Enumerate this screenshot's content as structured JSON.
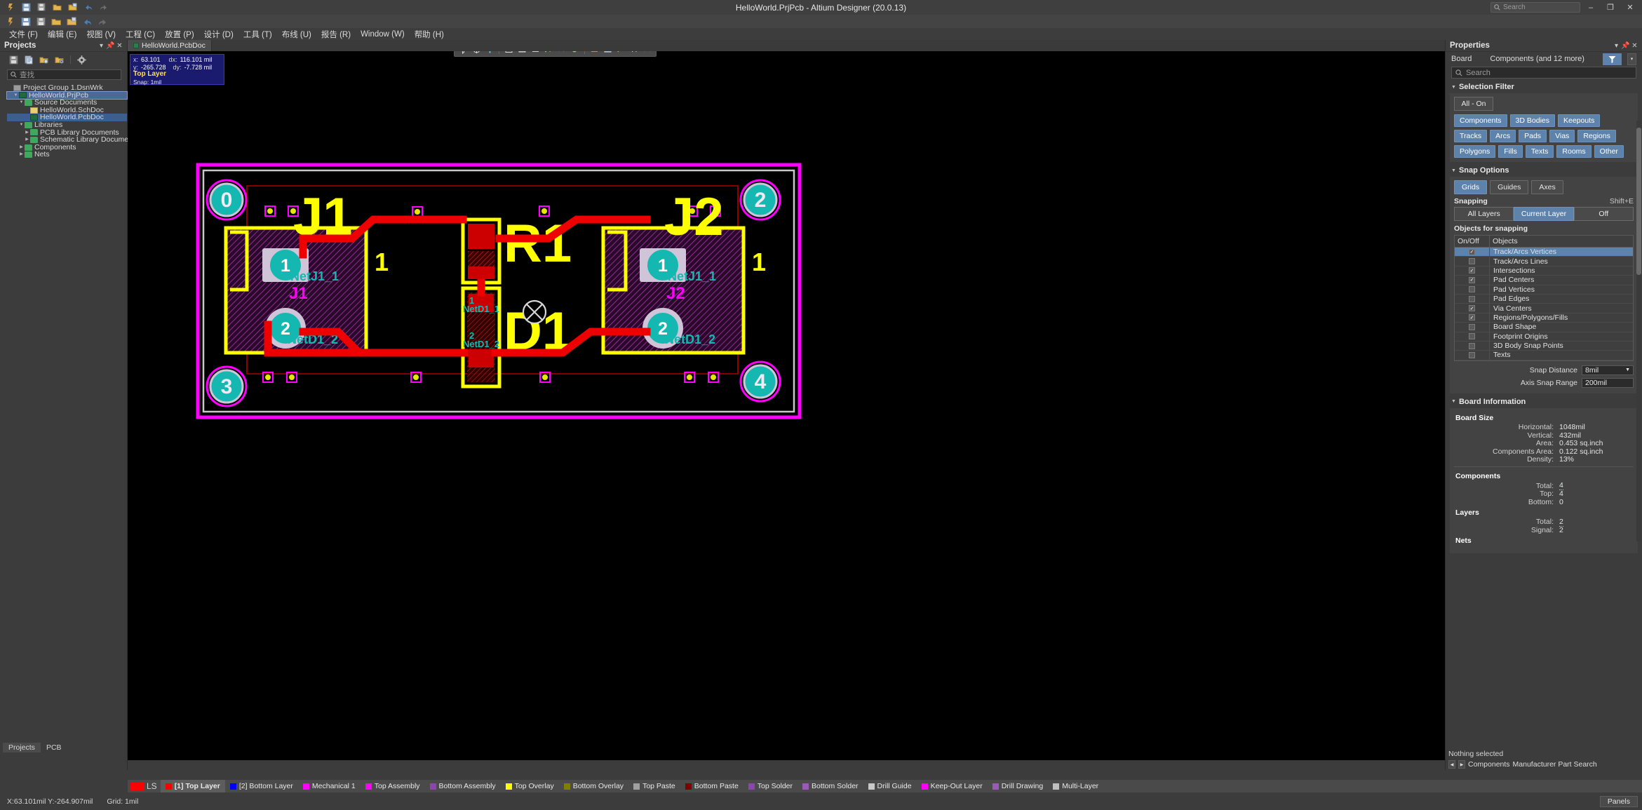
{
  "window": {
    "title": "HelloWorld.PrjPcb - Altium Designer (20.0.13)",
    "search_placeholder": "Search",
    "minimize": "–",
    "maximize": "❐",
    "close": "✕"
  },
  "menu": {
    "items": [
      "文件 (F)",
      "编辑 (E)",
      "视图 (V)",
      "工程 (C)",
      "放置 (P)",
      "设计 (D)",
      "工具 (T)",
      "布线 (U)",
      "报告 (R)",
      "Window (W)",
      "帮助 (H)"
    ]
  },
  "projects_panel": {
    "title": "Projects",
    "search_placeholder": "查找",
    "tree": [
      {
        "label": "Project Group 1.DsnWrk",
        "indent": 0,
        "arrow": "",
        "icon": "workspace-icon",
        "selected": false
      },
      {
        "label": "HelloWorld.PrjPcb",
        "indent": 1,
        "arrow": "▼",
        "icon": "pcb-project-icon",
        "selected": "outline"
      },
      {
        "label": "Source Documents",
        "indent": 2,
        "arrow": "▼",
        "icon": "folder-icon",
        "selected": false
      },
      {
        "label": "HelloWorld.SchDoc",
        "indent": 3,
        "arrow": "",
        "icon": "schematic-icon",
        "selected": false
      },
      {
        "label": "HelloWorld.PcbDoc",
        "indent": 3,
        "arrow": "",
        "icon": "pcbdoc-icon",
        "selected": true
      },
      {
        "label": "Libraries",
        "indent": 2,
        "arrow": "▼",
        "icon": "folder-icon",
        "selected": false
      },
      {
        "label": "PCB Library Documents",
        "indent": 3,
        "arrow": "▶",
        "icon": "folder-icon",
        "selected": false
      },
      {
        "label": "Schematic Library Documen",
        "indent": 3,
        "arrow": "▶",
        "icon": "folder-icon",
        "selected": false
      },
      {
        "label": "Components",
        "indent": 2,
        "arrow": "▶",
        "icon": "folder-icon",
        "selected": false
      },
      {
        "label": "Nets",
        "indent": 2,
        "arrow": "▶",
        "icon": "folder-icon",
        "selected": false
      }
    ],
    "bottom_tabs": [
      {
        "label": "Projects",
        "active": true
      },
      {
        "label": "PCB",
        "active": false
      }
    ]
  },
  "document_tabs": [
    {
      "label": "HelloWorld.PcbDoc",
      "active": true
    }
  ],
  "canvas_hud": {
    "x_label": "x:",
    "x_value": "63.101",
    "dx_label": "dx:",
    "dx_value": "116.101 mil",
    "y_label": "y:",
    "y_value": "-265.728",
    "dy_label": "dy:",
    "dy_value": "-7.728  mil",
    "layer": "Top Layer",
    "snap": "Snap: 1mil"
  },
  "pcb": {
    "designators": [
      "J1",
      "J2",
      "R1",
      "D1"
    ],
    "pad_labels": [
      "1",
      "2"
    ],
    "net_labels": [
      "NetJ1_1",
      "NetD1_2",
      "NetJ1_1",
      "NetD1_2",
      "NetD1_1",
      "NetD1_2"
    ],
    "mounting_holes": [
      "0",
      "2",
      "3",
      "4"
    ],
    "comp_names": [
      "J1",
      "J2"
    ],
    "pin_numbers": [
      "1",
      "1"
    ],
    "colors": {
      "board_outline": "#ff00ff",
      "top_layer": "#ff0000",
      "top_overlay": "#ffff00",
      "pad": "#bdb3c8",
      "keepout": "#ff00ff",
      "hole": "#14b8b0"
    }
  },
  "properties_panel": {
    "title": "Properties",
    "object_type": "Board",
    "object_summary": "Components (and 12 more)",
    "search_placeholder": "Search",
    "selection_filter": {
      "title": "Selection Filter",
      "all_on": "All - On",
      "chips": [
        {
          "label": "Components",
          "on": true
        },
        {
          "label": "3D Bodies",
          "on": true
        },
        {
          "label": "Keepouts",
          "on": true
        },
        {
          "label": "Tracks",
          "on": true
        },
        {
          "label": "Arcs",
          "on": true
        },
        {
          "label": "Pads",
          "on": true
        },
        {
          "label": "Vias",
          "on": true
        },
        {
          "label": "Regions",
          "on": true
        },
        {
          "label": "Polygons",
          "on": true
        },
        {
          "label": "Fills",
          "on": true
        },
        {
          "label": "Texts",
          "on": true
        },
        {
          "label": "Rooms",
          "on": true
        },
        {
          "label": "Other",
          "on": true
        }
      ]
    },
    "snap_options": {
      "title": "Snap Options",
      "modes": [
        {
          "label": "Grids",
          "on": true
        },
        {
          "label": "Guides",
          "on": false
        },
        {
          "label": "Axes",
          "on": false
        }
      ],
      "snapping_label": "Snapping",
      "snapping_shortcut": "Shift+E",
      "snapping_segments": [
        {
          "label": "All Layers",
          "on": false
        },
        {
          "label": "Current Layer",
          "on": true
        },
        {
          "label": "Off",
          "on": false
        }
      ],
      "objects_label": "Objects for snapping",
      "table_headers": [
        "On/Off",
        "Objects"
      ],
      "objects": [
        {
          "label": "Track/Arcs Vertices",
          "checked": true,
          "selected": true
        },
        {
          "label": "Track/Arcs Lines",
          "checked": false,
          "selected": false
        },
        {
          "label": "Intersections",
          "checked": true,
          "selected": false
        },
        {
          "label": "Pad Centers",
          "checked": true,
          "selected": false
        },
        {
          "label": "Pad Vertices",
          "checked": false,
          "selected": false
        },
        {
          "label": "Pad Edges",
          "checked": false,
          "selected": false
        },
        {
          "label": "Via Centers",
          "checked": true,
          "selected": false
        },
        {
          "label": "Regions/Polygons/Fills",
          "checked": true,
          "selected": false
        },
        {
          "label": "Board Shape",
          "checked": false,
          "selected": false
        },
        {
          "label": "Footprint Origins",
          "checked": false,
          "selected": false
        },
        {
          "label": "3D Body Snap Points",
          "checked": false,
          "selected": false
        },
        {
          "label": "Texts",
          "checked": false,
          "selected": false
        }
      ],
      "snap_distance_label": "Snap Distance",
      "snap_distance_value": "8mil",
      "axis_snap_label": "Axis Snap Range",
      "axis_snap_value": "200mil"
    },
    "board_information": {
      "title": "Board Information",
      "board_size_label": "Board Size",
      "rows": [
        {
          "k": "Horizontal:",
          "v": "1048mil",
          "link": false
        },
        {
          "k": "Vertical:",
          "v": "432mil",
          "link": false
        },
        {
          "k": "Area:",
          "v": "0.453 sq.inch",
          "link": false
        },
        {
          "k": "Components Area:",
          "v": "0.122 sq.inch",
          "link": false
        },
        {
          "k": "Density:",
          "v": "13%",
          "link": false
        }
      ],
      "components_label": "Components",
      "components_rows": [
        {
          "k": "Total:",
          "v": "4",
          "link": true
        },
        {
          "k": "Top:",
          "v": "4",
          "link": false
        },
        {
          "k": "Bottom:",
          "v": "0",
          "link": false
        }
      ],
      "layers_label": "Layers",
      "layers_rows": [
        {
          "k": "Total:",
          "v": "2",
          "link": true
        },
        {
          "k": "Signal:",
          "v": "2",
          "link": false
        }
      ],
      "nets_label": "Nets"
    },
    "footer": {
      "status": "Nothing selected",
      "tabs": [
        "Components",
        "Manufacturer Part Search"
      ]
    }
  },
  "layer_tabs": {
    "ls_label": "LS",
    "tabs": [
      {
        "label": "[1] Top Layer",
        "color": "#ff0000",
        "active": true
      },
      {
        "label": "[2] Bottom Layer",
        "color": "#0000ff",
        "active": false
      },
      {
        "label": "Mechanical 1",
        "color": "#ff00ff",
        "active": false
      },
      {
        "label": "Top Assembly",
        "color": "#ff00ff",
        "active": false
      },
      {
        "label": "Bottom Assembly",
        "color": "#8e44ad",
        "active": false
      },
      {
        "label": "Top Overlay",
        "color": "#ffff00",
        "active": false
      },
      {
        "label": "Bottom Overlay",
        "color": "#808000",
        "active": false
      },
      {
        "label": "Top Paste",
        "color": "#a0a0a0",
        "active": false
      },
      {
        "label": "Bottom Paste",
        "color": "#800000",
        "active": false
      },
      {
        "label": "Top Solder",
        "color": "#8e44ad",
        "active": false
      },
      {
        "label": "Bottom Solder",
        "color": "#9b59b6",
        "active": false
      },
      {
        "label": "Drill Guide",
        "color": "#c8c8c8",
        "active": false
      },
      {
        "label": "Keep-Out Layer",
        "color": "#ff00ff",
        "active": false
      },
      {
        "label": "Drill Drawing",
        "color": "#9b59b6",
        "active": false
      },
      {
        "label": "Multi-Layer",
        "color": "#c0c0c0",
        "active": false
      }
    ]
  },
  "statusbar": {
    "coords": "X:63.101mil Y:-264.907mil",
    "grid": "Grid: 1mil",
    "panels_button": "Panels"
  }
}
